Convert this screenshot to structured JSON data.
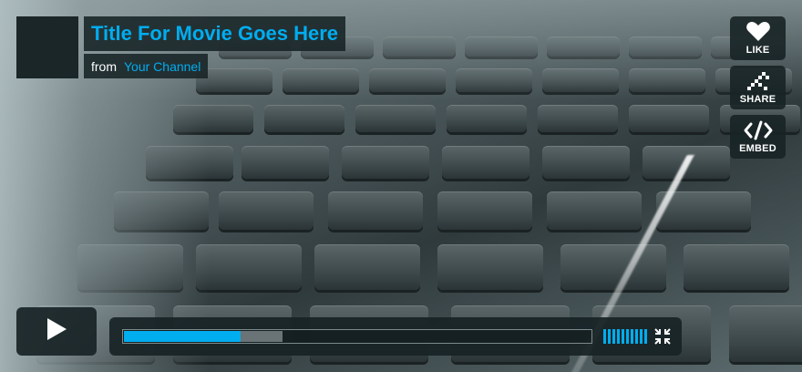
{
  "video": {
    "title": "Title For Movie Goes Here",
    "byline_from": "from",
    "channel_name": "Your Channel"
  },
  "side_actions": [
    {
      "label": "LIKE",
      "icon": "heart-icon"
    },
    {
      "label": "SHARE",
      "icon": "share-icon"
    },
    {
      "label": "EMBED",
      "icon": "embed-code-icon"
    }
  ],
  "controls": {
    "play_icon": "play-icon",
    "progress_played_fraction": 0.25,
    "progress_loaded_fraction": 0.34,
    "volume_level_bars": 10,
    "fullscreen_icon": "fullscreen-icon"
  },
  "colors": {
    "accent": "#00adef",
    "panel": "#172325",
    "text": "#ffffff"
  }
}
